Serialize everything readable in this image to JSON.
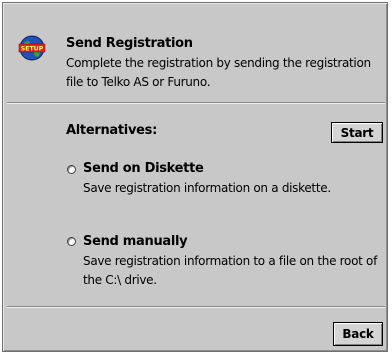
{
  "header": {
    "logo_text": "SETUP",
    "title": "Send Registration",
    "description": "Complete the registration by sending the registration file to Telko AS or Furuno."
  },
  "alternatives": {
    "label": "Alternatives:",
    "start_label": "Start",
    "options": [
      {
        "title": "Send on Diskette",
        "description": "Save registration information on a diskette.",
        "selected": false
      },
      {
        "title": "Send manually",
        "description": "Save registration information to a file on the root of the C:\\ drive.",
        "selected": false
      }
    ]
  },
  "footer": {
    "back_label": "Back"
  },
  "colors": {
    "window_bg": "#c8c8c8",
    "logo_globe": "#2050b8",
    "logo_land": "#38a040",
    "logo_banner": "#e02020"
  }
}
